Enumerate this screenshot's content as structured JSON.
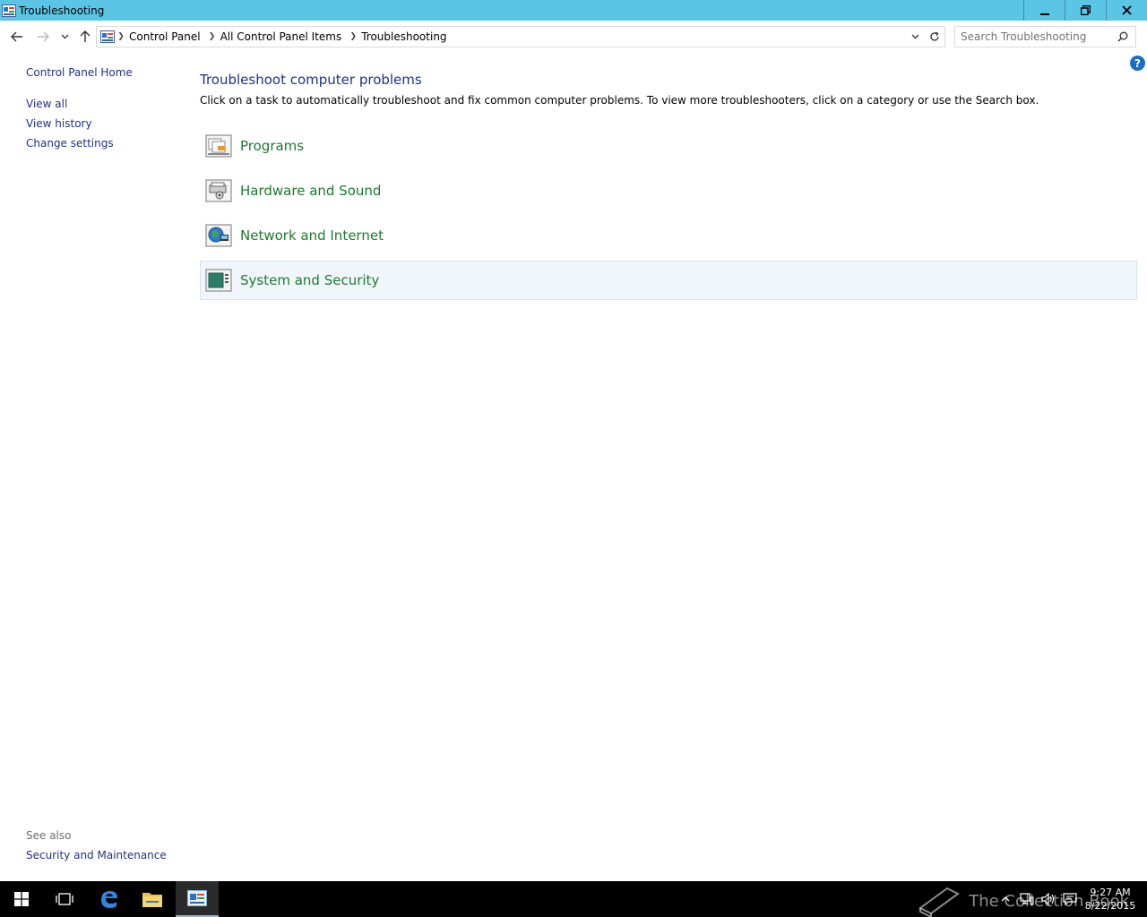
{
  "window": {
    "title": "Troubleshooting"
  },
  "breadcrumb": {
    "items": [
      "Control Panel",
      "All Control Panel Items",
      "Troubleshooting"
    ]
  },
  "search": {
    "placeholder": "Search Troubleshooting"
  },
  "leftnav": {
    "home": "Control Panel Home",
    "items": [
      "View all",
      "View history",
      "Change settings"
    ],
    "see_also_label": "See also",
    "see_also_items": [
      "Security and Maintenance"
    ]
  },
  "main": {
    "heading": "Troubleshoot computer problems",
    "description": "Click on a task to automatically troubleshoot and fix common computer problems. To view more troubleshooters, click on a category or use the Search box.",
    "categories": [
      {
        "label": "Programs",
        "icon": "programs-icon"
      },
      {
        "label": "Hardware and Sound",
        "icon": "hardware-sound-icon"
      },
      {
        "label": "Network and Internet",
        "icon": "network-internet-icon"
      },
      {
        "label": "System and Security",
        "icon": "system-security-icon"
      }
    ]
  },
  "help": {
    "label": "?"
  },
  "taskbar": {
    "clock_time": "9:27 AM",
    "clock_date": "8/22/2015",
    "watermark": "The Collection Book"
  },
  "colors": {
    "titlebar": "#5bc5e6",
    "link": "#1e3287",
    "category_link": "#1e7a2e",
    "hover_bg": "#f0f6fc"
  }
}
